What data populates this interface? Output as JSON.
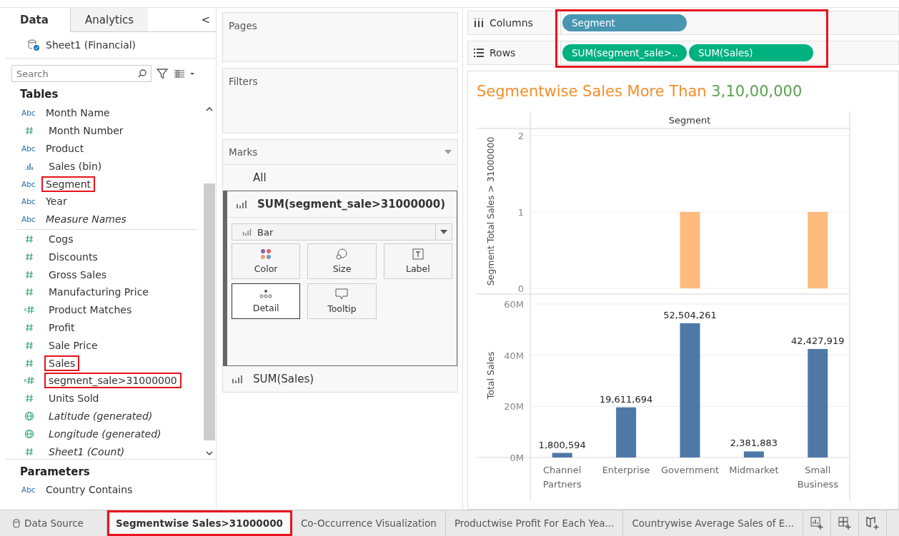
{
  "data_pane": {
    "tabs": [
      {
        "label": "Data",
        "selected": true
      },
      {
        "label": "Analytics",
        "selected": false
      }
    ],
    "collapse_glyph": "<",
    "source": "Sheet1 (Financial)",
    "search": {
      "placeholder": "Search"
    },
    "tables_heading": "Tables",
    "fields": [
      {
        "kind": "string",
        "badge": "Abc",
        "name": "Month Name",
        "italic": false,
        "highlighted": false
      },
      {
        "kind": "number",
        "name": "Month Number",
        "italic": false,
        "highlighted": false
      },
      {
        "kind": "string",
        "badge": "Abc",
        "name": "Product",
        "italic": false,
        "highlighted": false
      },
      {
        "kind": "bin",
        "name": "Sales (bin)",
        "italic": false,
        "highlighted": false
      },
      {
        "kind": "string",
        "badge": "Abc",
        "name": "Segment",
        "italic": false,
        "highlighted": true
      },
      {
        "kind": "string",
        "badge": "Abc",
        "name": "Year",
        "italic": false,
        "highlighted": false
      },
      {
        "kind": "string",
        "badge": "Abc",
        "name": "Measure Names",
        "italic": true,
        "highlighted": false
      },
      {
        "kind": "divider"
      },
      {
        "kind": "number",
        "name": "Cogs",
        "italic": false,
        "highlighted": false
      },
      {
        "kind": "number",
        "name": "Discounts",
        "italic": false,
        "highlighted": false
      },
      {
        "kind": "number",
        "name": "Gross Sales",
        "italic": false,
        "highlighted": false
      },
      {
        "kind": "number",
        "name": "Manufacturing Price",
        "italic": false,
        "highlighted": false
      },
      {
        "kind": "calculated",
        "name": "Product Matches",
        "italic": false,
        "highlighted": false
      },
      {
        "kind": "number",
        "name": "Profit",
        "italic": false,
        "highlighted": false
      },
      {
        "kind": "number",
        "name": "Sale Price",
        "italic": false,
        "highlighted": false
      },
      {
        "kind": "number",
        "name": "Sales",
        "italic": false,
        "highlighted": true
      },
      {
        "kind": "calculated",
        "name": "segment_sale>31000000",
        "italic": false,
        "highlighted": true
      },
      {
        "kind": "number",
        "name": "Units Sold",
        "italic": false,
        "highlighted": false
      },
      {
        "kind": "geo",
        "name": "Latitude (generated)",
        "italic": true,
        "highlighted": false
      },
      {
        "kind": "geo",
        "name": "Longitude (generated)",
        "italic": true,
        "highlighted": false
      },
      {
        "kind": "number",
        "name": "Sheet1 (Count)",
        "italic": true,
        "highlighted": false
      }
    ],
    "parameters_heading": "Parameters",
    "parameters": [
      {
        "kind": "string",
        "badge": "Abc",
        "name": "Country Contains"
      }
    ]
  },
  "shelves": {
    "pages": "Pages",
    "filters": "Filters",
    "marks": {
      "heading": "Marks",
      "cards": [
        {
          "label": "All",
          "expanded": false
        },
        {
          "label": "SUM(segment_sale>31000000)",
          "expanded": true,
          "mark_type": "Bar",
          "properties": [
            {
              "label": "Color",
              "kind": "color",
              "selected": false
            },
            {
              "label": "Size",
              "kind": "size",
              "selected": false
            },
            {
              "label": "Label",
              "kind": "label",
              "selected": false
            },
            {
              "label": "Detail",
              "kind": "detail",
              "selected": true
            },
            {
              "label": "Tooltip",
              "kind": "tooltip",
              "selected": false
            }
          ]
        },
        {
          "label": "SUM(Sales)",
          "expanded": false
        }
      ]
    },
    "columns": {
      "label": "Columns",
      "pills": [
        {
          "text": "Segment",
          "kind": "dimension"
        }
      ]
    },
    "rows": {
      "label": "Rows",
      "pills": [
        {
          "text": "SUM(segment_sale>..",
          "kind": "measure"
        },
        {
          "text": "SUM(Sales)",
          "kind": "measure"
        }
      ]
    },
    "highlighted": true
  },
  "view": {
    "title_text": "Segmentwise Sales More Than",
    "title_number": "3,10,00,000",
    "column_header": "Segment",
    "charts": [
      {
        "chart_data": {
          "type": "bar",
          "ylabel": "Segment Total Sales > 31000000",
          "series": [
            {
              "color": "#fdbb7c",
              "values": [
                0,
                0,
                1,
                0,
                1
              ]
            }
          ],
          "ylim": [
            0,
            2
          ],
          "yticks": [
            0,
            1,
            2
          ]
        }
      },
      {
        "chart_data": {
          "type": "bar",
          "ylabel": "Total Sales",
          "categories": [
            "Channel Partners",
            "Enterprise",
            "Government",
            "Midmarket",
            "Small Business"
          ],
          "series": [
            {
              "color": "#4e79a7",
              "values": [
                1800594,
                19611694,
                52504261,
                2381883,
                42427919
              ]
            }
          ],
          "ylim": [
            0,
            60000000
          ],
          "yticks": [
            {
              "value": 0,
              "label": "0M"
            },
            {
              "value": 20000000,
              "label": "20M"
            },
            {
              "value": 40000000,
              "label": "40M"
            },
            {
              "value": 60000000,
              "label": "60M"
            }
          ],
          "value_labels": [
            "1,800,594",
            "19,611,694",
            "52,504,261",
            "2,381,883",
            "42,427,919"
          ]
        }
      }
    ]
  },
  "sheet_tabs": [
    {
      "label": "Data Source",
      "kind": "source",
      "selected": false,
      "highlighted": false
    },
    {
      "label": "Segmentwise Sales>31000000",
      "kind": "sheet",
      "selected": true,
      "highlighted": true
    },
    {
      "label": "Co-Occurrence Visualization",
      "kind": "sheet",
      "selected": false,
      "highlighted": false
    },
    {
      "label": "Productwise Profit For Each Yea...",
      "kind": "sheet",
      "selected": false,
      "highlighted": false
    },
    {
      "label": "Countrywise Average Sales of E...",
      "kind": "sheet",
      "selected": false,
      "highlighted": false
    }
  ],
  "new_buttons": [
    {
      "kind": "worksheet"
    },
    {
      "kind": "dashboard"
    },
    {
      "kind": "story"
    }
  ]
}
